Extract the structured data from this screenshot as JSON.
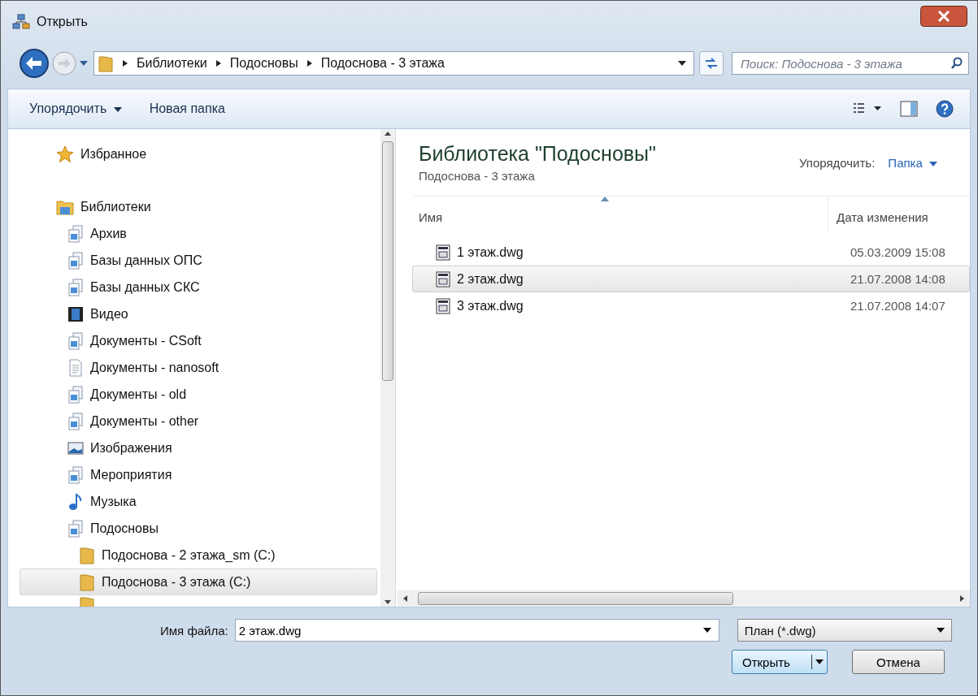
{
  "window": {
    "title": "Открыть"
  },
  "address": {
    "crumbs": [
      "Библиотеки",
      "Подосновы",
      "Подоснова - 3 этажа"
    ],
    "search_placeholder": "Поиск: Подоснова - 3 этажа"
  },
  "toolbar": {
    "organize": "Упорядочить",
    "new_folder": "Новая папка"
  },
  "nav_tree": [
    {
      "kind": "favorite",
      "label": "Избранное",
      "selected": false
    },
    {
      "kind": "libraries",
      "label": "Библиотеки",
      "selected": false,
      "children": [
        {
          "kind": "library",
          "label": "Архив",
          "selected": false
        },
        {
          "kind": "library",
          "label": "Базы данных ОПС",
          "selected": false
        },
        {
          "kind": "library",
          "label": "Базы данных СКС",
          "selected": false
        },
        {
          "kind": "video",
          "label": "Видео",
          "selected": false
        },
        {
          "kind": "library",
          "label": "Документы - CSoft",
          "selected": false
        },
        {
          "kind": "document",
          "label": "Документы - nanosoft",
          "selected": false
        },
        {
          "kind": "library",
          "label": "Документы - old",
          "selected": false
        },
        {
          "kind": "library",
          "label": "Документы - other",
          "selected": false
        },
        {
          "kind": "images",
          "label": "Изображения",
          "selected": false
        },
        {
          "kind": "library",
          "label": "Мероприятия",
          "selected": false
        },
        {
          "kind": "music",
          "label": "Музыка",
          "selected": false
        },
        {
          "kind": "library",
          "label": "Подосновы",
          "selected": false,
          "children": [
            {
              "kind": "folder",
              "label": "Подоснова - 2 этажа_sm (C:)",
              "selected": false
            },
            {
              "kind": "folder",
              "label": "Подоснова - 3 этажа (C:)",
              "selected": true
            }
          ]
        }
      ]
    }
  ],
  "library_header": {
    "title": "Библиотека \"Подосновы\"",
    "subtitle": "Подоснова - 3 этажа",
    "arrange_label": "Упорядочить:",
    "arrange_value": "Папка"
  },
  "columns": [
    "Имя",
    "Дата изменения"
  ],
  "files": [
    {
      "name": "1 этаж.dwg",
      "date": "05.03.2009 15:08",
      "selected": false
    },
    {
      "name": "2 этаж.dwg",
      "date": "21.07.2008 14:08",
      "selected": true
    },
    {
      "name": "3 этаж.dwg",
      "date": "21.07.2008 14:07",
      "selected": false
    }
  ],
  "footer": {
    "file_name_label": "Имя файла:",
    "file_name": "2 этаж.dwg",
    "file_type": "План (*.dwg)",
    "open": "Открыть",
    "cancel": "Отмена"
  }
}
